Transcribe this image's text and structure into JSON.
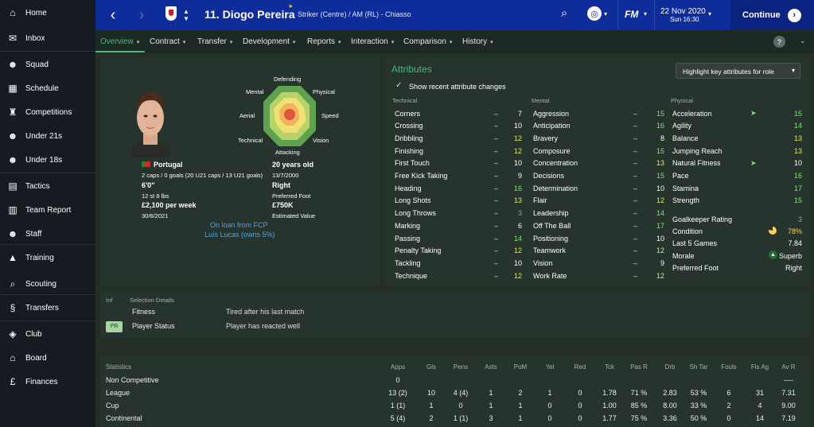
{
  "sidebar": {
    "items": [
      {
        "label": "Home",
        "icon": "home-icon"
      },
      {
        "label": "Inbox",
        "icon": "inbox-icon"
      },
      {
        "label": "Squad",
        "icon": "squad-icon"
      },
      {
        "label": "Schedule",
        "icon": "calendar-icon"
      },
      {
        "label": "Competitions",
        "icon": "trophy-icon"
      },
      {
        "label": "Under 21s",
        "icon": "u21-icon"
      },
      {
        "label": "Under 18s",
        "icon": "u18-icon"
      },
      {
        "label": "Tactics",
        "icon": "tactics-icon"
      },
      {
        "label": "Team Report",
        "icon": "report-icon"
      },
      {
        "label": "Staff",
        "icon": "staff-icon"
      },
      {
        "label": "Training",
        "icon": "training-icon"
      },
      {
        "label": "Scouting",
        "icon": "search-icon"
      },
      {
        "label": "Transfers",
        "icon": "transfers-icon"
      },
      {
        "label": "Club",
        "icon": "club-icon"
      },
      {
        "label": "Board",
        "icon": "board-icon"
      },
      {
        "label": "Finances",
        "icon": "finances-icon"
      }
    ]
  },
  "header": {
    "player_name": "11. Diogo Pereira",
    "role": "Striker (Centre) / AM (RL) - Chiasso",
    "logo": "FM",
    "date": "22 Nov 2020",
    "time": "Sun 16:30",
    "continue_label": "Continue"
  },
  "tabs": [
    "Overview",
    "Contract",
    "Transfer",
    "Development",
    "Reports",
    "Interaction",
    "Comparison",
    "History"
  ],
  "profile": {
    "radar_labels": {
      "top": "Defending",
      "top_right": "Physical",
      "right": "Speed",
      "bottom_right": "Vision",
      "bottom": "Attacking",
      "bottom_left": "Technical",
      "left": "Aerial",
      "top_left": "Mental"
    },
    "nationality": "Portugal",
    "caps": "2 caps / 0 goals (20 U21 caps / 13 U21 goals)",
    "age": "20 years old",
    "dob": "13/7/2000",
    "height": "6'0\"",
    "foot": "Right",
    "weight": "12 st 8 lbs",
    "foot_label": "Preferred Foot",
    "wage": "£2,100 per week",
    "value": "£750K",
    "contract_end": "30/6/2021",
    "value_label": "Estimated Value",
    "loan_line1": "On loan from FCP",
    "loan_line2": "Luís Lucas (owns 5%)"
  },
  "attributes": {
    "title": "Attributes",
    "highlight_btn": "Highlight key attributes for role",
    "show_changes": "Show recent attribute changes",
    "technical_head": "Technical",
    "mental_head": "Mental",
    "physical_head": "Physical",
    "technical": [
      {
        "name": "Corners",
        "value": "7",
        "color": "#ffffff"
      },
      {
        "name": "Crossing",
        "value": "10",
        "color": "#ffffff"
      },
      {
        "name": "Dribbling",
        "value": "12",
        "color": "#d7f06b"
      },
      {
        "name": "Finishing",
        "value": "12",
        "color": "#d7f06b"
      },
      {
        "name": "First Touch",
        "value": "10",
        "color": "#ffffff"
      },
      {
        "name": "Free Kick Taking",
        "value": "9",
        "color": "#ffffff"
      },
      {
        "name": "Heading",
        "value": "16",
        "color": "#7fe37a"
      },
      {
        "name": "Long Shots",
        "value": "13",
        "color": "#d7f06b"
      },
      {
        "name": "Long Throws",
        "value": "3",
        "color": "#9e9e9e"
      },
      {
        "name": "Marking",
        "value": "6",
        "color": "#ffffff"
      },
      {
        "name": "Passing",
        "value": "14",
        "color": "#7fe37a"
      },
      {
        "name": "Penalty Taking",
        "value": "12",
        "color": "#d7f06b"
      },
      {
        "name": "Tackling",
        "value": "10",
        "color": "#ffffff"
      },
      {
        "name": "Technique",
        "value": "12",
        "color": "#d7f06b"
      }
    ],
    "mental": [
      {
        "name": "Aggression",
        "value": "15",
        "color": "#7fe37a"
      },
      {
        "name": "Anticipation",
        "value": "16",
        "color": "#7fe37a"
      },
      {
        "name": "Bravery",
        "value": "8",
        "color": "#ffffff"
      },
      {
        "name": "Composure",
        "value": "15",
        "color": "#7fe37a"
      },
      {
        "name": "Concentration",
        "value": "13",
        "color": "#d7f06b"
      },
      {
        "name": "Decisions",
        "value": "15",
        "color": "#7fe37a"
      },
      {
        "name": "Determination",
        "value": "10",
        "color": "#ffffff"
      },
      {
        "name": "Flair",
        "value": "12",
        "color": "#d7f06b"
      },
      {
        "name": "Leadership",
        "value": "14",
        "color": "#7fe37a"
      },
      {
        "name": "Off The Ball",
        "value": "17",
        "color": "#7fe37a"
      },
      {
        "name": "Positioning",
        "value": "10",
        "color": "#ffffff"
      },
      {
        "name": "Teamwork",
        "value": "12",
        "color": "#d7f06b"
      },
      {
        "name": "Vision",
        "value": "9",
        "color": "#ffffff"
      },
      {
        "name": "Work Rate",
        "value": "12",
        "color": "#d7f06b"
      }
    ],
    "physical": [
      {
        "name": "Acceleration",
        "value": "15",
        "color": "#7fe37a",
        "arrow": true
      },
      {
        "name": "Agility",
        "value": "14",
        "color": "#7fe37a"
      },
      {
        "name": "Balance",
        "value": "13",
        "color": "#d7f06b"
      },
      {
        "name": "Jumping Reach",
        "value": "13",
        "color": "#d7f06b"
      },
      {
        "name": "Natural Fitness",
        "value": "10",
        "color": "#ffffff",
        "arrow": true
      },
      {
        "name": "Pace",
        "value": "16",
        "color": "#7fe37a"
      },
      {
        "name": "Stamina",
        "value": "17",
        "color": "#7fe37a"
      },
      {
        "name": "Strength",
        "value": "15",
        "color": "#7fe37a"
      }
    ],
    "extras": [
      {
        "name": "Goalkeeper Rating",
        "value": "3"
      },
      {
        "name": "Condition",
        "value": "78%"
      },
      {
        "name": "Last 5 Games",
        "value": "7.84"
      },
      {
        "name": "Morale",
        "value": "Superb"
      },
      {
        "name": "Preferred Foot",
        "value": "Right"
      }
    ],
    "condition_fraction": 0.78
  },
  "selection": {
    "inf_head": "Inf",
    "head": "Selection Details",
    "rows": [
      {
        "badge": "",
        "label": "Fitness",
        "value": "Tired after his last match"
      },
      {
        "badge": "PR",
        "label": "Player Status",
        "value": "Player has reacted well"
      }
    ]
  },
  "statistics": {
    "columns": [
      "Statistics",
      "Apps",
      "Gls",
      "Pens",
      "Asts",
      "PoM",
      "Yel",
      "Red",
      "Tck",
      "Pas R",
      "Drb",
      "Sh Tar",
      "Fouls",
      "Fls Ag",
      "Av R"
    ],
    "rows": [
      [
        "Non Competitive",
        "0",
        "",
        "",
        "",
        "",
        "",
        "",
        "",
        "",
        "",
        "",
        "",
        "",
        "----"
      ],
      [
        "League",
        "13 (2)",
        "10",
        "4 (4)",
        "1",
        "2",
        "1",
        "0",
        "1.78",
        "71 %",
        "2.83",
        "53 %",
        "6",
        "31",
        "7.31"
      ],
      [
        "Cup",
        "1 (1)",
        "1",
        "0",
        "1",
        "1",
        "0",
        "0",
        "1.00",
        "85 %",
        "8.00",
        "33 %",
        "2",
        "4",
        "9.00"
      ],
      [
        "Continental",
        "5 (4)",
        "2",
        "1 (1)",
        "3",
        "1",
        "0",
        "0",
        "1.77",
        "75 %",
        "3.36",
        "50 %",
        "0",
        "14",
        "7.19"
      ]
    ]
  }
}
